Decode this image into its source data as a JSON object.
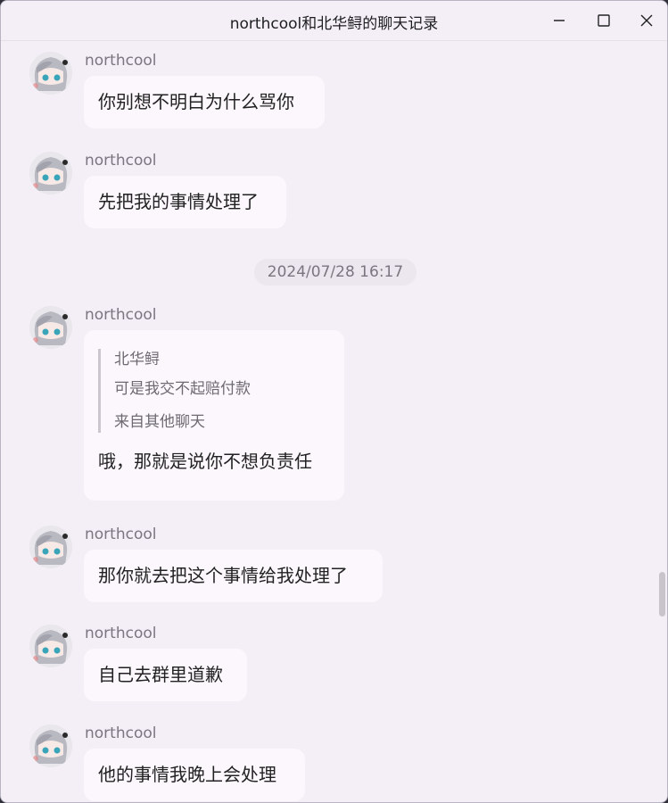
{
  "window": {
    "title": "northcool和北华鲟的聊天记录"
  },
  "timestamp": "2024/07/28 16:17",
  "messages": [
    {
      "sender": "northcool",
      "text": "你别想不明白为什么骂你"
    },
    {
      "sender": "northcool",
      "text": "先把我的事情处理了"
    },
    {
      "sender": "northcool",
      "text": "哦，那就是说你不想负责任",
      "quote": {
        "author": "北华鲟",
        "text": "可是我交不起赔付款",
        "source": "来自其他聊天"
      }
    },
    {
      "sender": "northcool",
      "text": "那你就去把这个事情给我处理了"
    },
    {
      "sender": "northcool",
      "text": "自己去群里道歉"
    },
    {
      "sender": "northcool",
      "text": "他的事情我晚上会处理"
    }
  ]
}
